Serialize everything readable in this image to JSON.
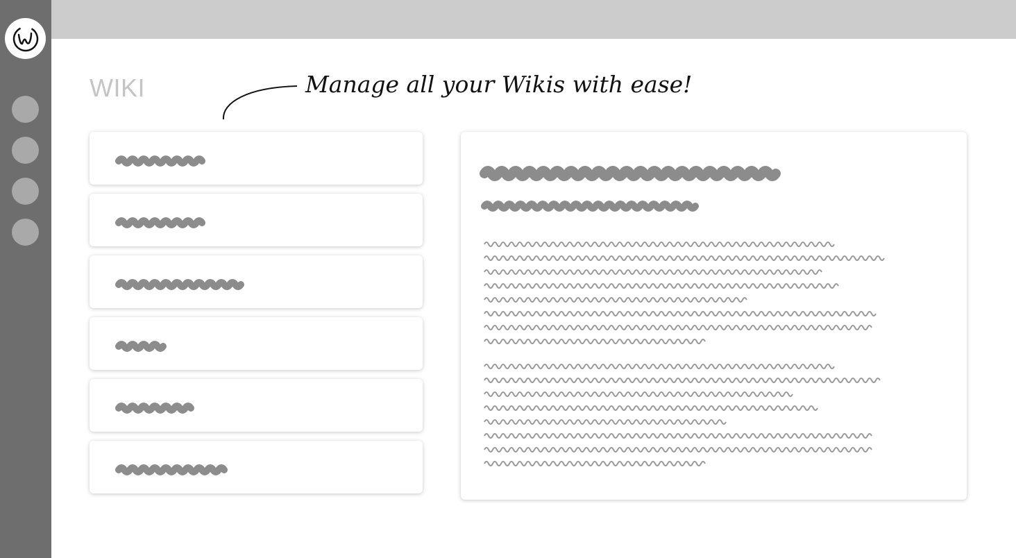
{
  "header": {
    "section_title": "WIKI",
    "tagline": "Manage all your Wikis with ease!"
  },
  "sidebar": {
    "logo_icon": "wiki-logo-icon",
    "nav_items": [
      {
        "icon": "nav-dot-icon"
      },
      {
        "icon": "nav-dot-icon"
      },
      {
        "icon": "nav-dot-icon"
      },
      {
        "icon": "nav-dot-icon"
      }
    ]
  },
  "colors": {
    "sidebar": "#6e6e6e",
    "topbar": "#cccccc",
    "placeholder": "#9a9a9a",
    "nav_dot": "#a9a9a9"
  }
}
